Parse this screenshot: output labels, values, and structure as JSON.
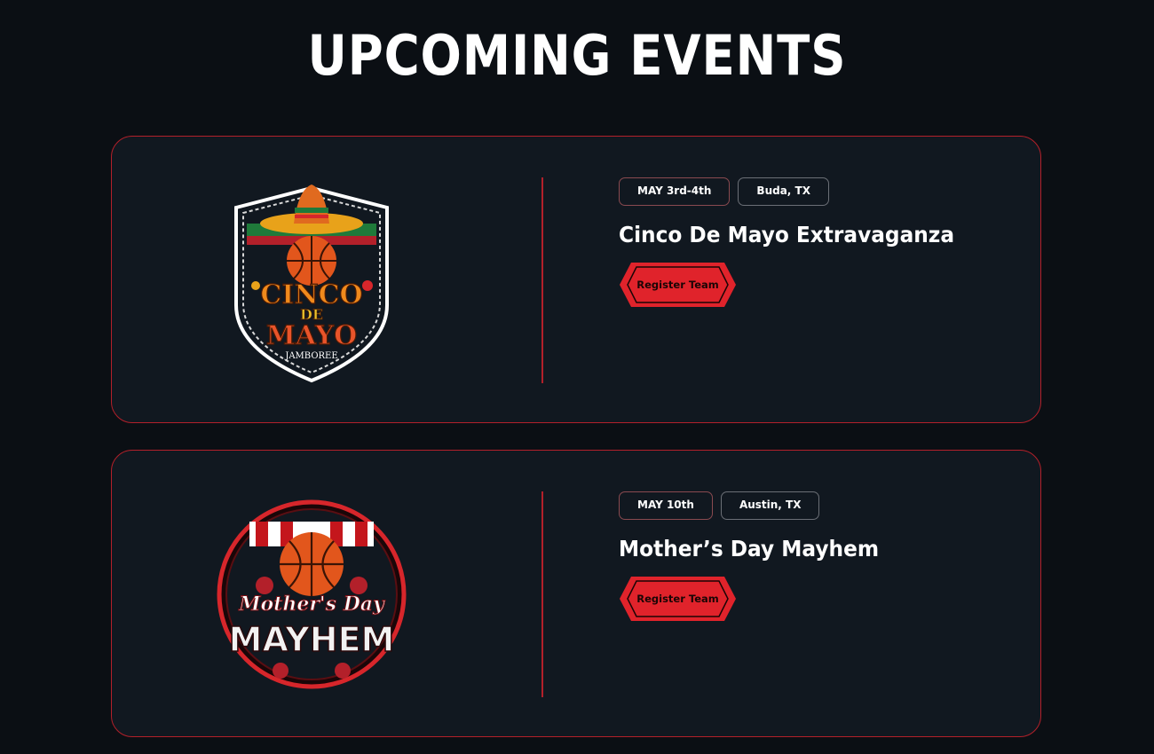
{
  "page": {
    "heading": "UPCOMING EVENTS"
  },
  "colors": {
    "background": "#0b0f14",
    "card_background": "#111820",
    "accent_red": "#e0232b",
    "card_border": "#b3202a"
  },
  "events": [
    {
      "date": "MAY 3rd-4th",
      "location": "Buda, TX",
      "title": "Cinco De Mayo Extravaganza",
      "button_label": "Register Team",
      "logo": {
        "icon": "cinco-de-mayo-jamboree-logo",
        "line1": "CINCO",
        "line2": "DE",
        "line3": "MAYO",
        "line4": "JAMBOREE"
      }
    },
    {
      "date": "MAY 10th",
      "location": "Austin, TX",
      "title": "Mother’s Day Mayhem",
      "button_label": "Register Team",
      "logo": {
        "icon": "mothers-day-mayhem-logo",
        "line1": "Mother's Day",
        "line2": "MAYHEM"
      }
    }
  ]
}
